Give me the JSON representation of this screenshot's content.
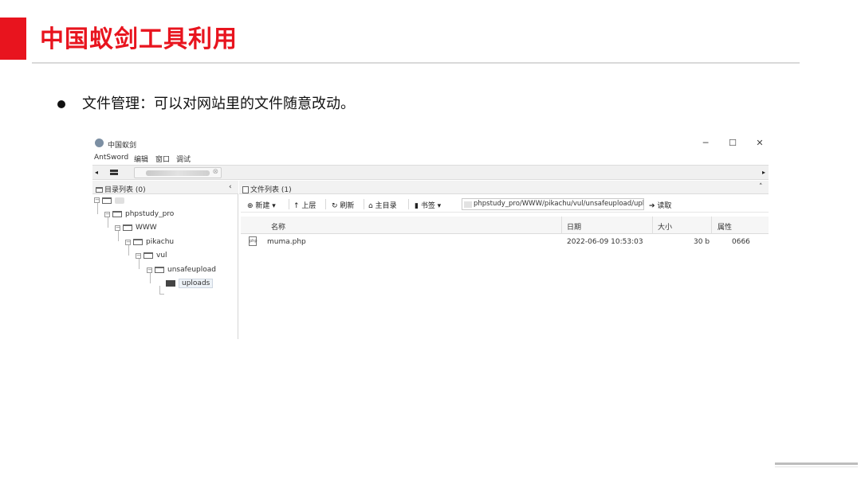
{
  "slide": {
    "title": "中国蚁剑工具利用",
    "bullet": "文件管理：可以对网站里的文件随意改动。"
  },
  "window": {
    "title": "中国蚁剑",
    "controls": {
      "minimize": "─",
      "maximize": "☐",
      "close": "✕"
    }
  },
  "menu": {
    "items": [
      "AntSword",
      "编辑",
      "窗口",
      "调试"
    ]
  },
  "tabs": {
    "left_arrow": "◂",
    "right_arrow": "▸",
    "close": "⊗"
  },
  "dir_panel": {
    "title": "目录列表 (0)",
    "collapse": "‹",
    "tree": [
      {
        "label": "phpstudy_pro"
      },
      {
        "label": "WWW"
      },
      {
        "label": "pikachu"
      },
      {
        "label": "vul"
      },
      {
        "label": "unsafeupload"
      },
      {
        "label": "uploads",
        "selected": true
      }
    ]
  },
  "file_panel": {
    "title": "文件列表 (1)",
    "collapse": "˄",
    "toolbar": {
      "new_label": "⊕ 新建 ▾",
      "up_label": "↑ 上层",
      "refresh_label": "↻ 刷新",
      "home_label": "⌂ 主目录",
      "bookmark_label": "▮ 书签 ▾",
      "path_value": "phpstudy_pro/WWW/pikachu/vul/unsafeupload/uploa",
      "read_label": "➔ 读取"
    },
    "columns": {
      "name": "名称",
      "date": "日期",
      "size": "大小",
      "attr": "属性"
    },
    "files": [
      {
        "name": "muma.php",
        "date": "2022-06-09 10:53:03",
        "size": "30 b",
        "attr": "0666",
        "icon": "php-file-icon"
      }
    ]
  },
  "colors": {
    "accent": "#e8141e"
  }
}
